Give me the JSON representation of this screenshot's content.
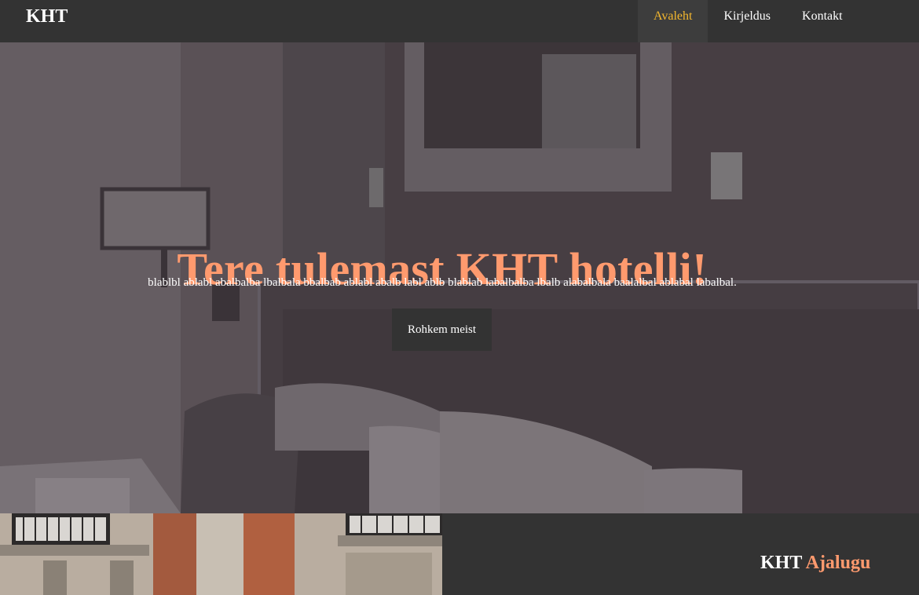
{
  "nav": {
    "brand": "KHT",
    "items": [
      {
        "label": "Avaleht",
        "active": true
      },
      {
        "label": "Kirjeldus",
        "active": false
      },
      {
        "label": "Kontakt",
        "active": false
      }
    ],
    "active_color": "#f5b82e"
  },
  "hero": {
    "title": "Tere tulemast KHT hotelli!",
    "text": "blablbl ablabl abalbalba lbalbala bbalbab ablabl abalb labl ablb blablab labalbalba lbalb alabalbala baalalbal ablabal labalbal.",
    "button_label": "Rohkem meist",
    "title_color": "#ff9a6e",
    "background_image": "hotel-room-photo"
  },
  "history": {
    "title_part1": "KHT",
    "title_part2": "Ajalugu",
    "image": "building-facade-photo"
  }
}
